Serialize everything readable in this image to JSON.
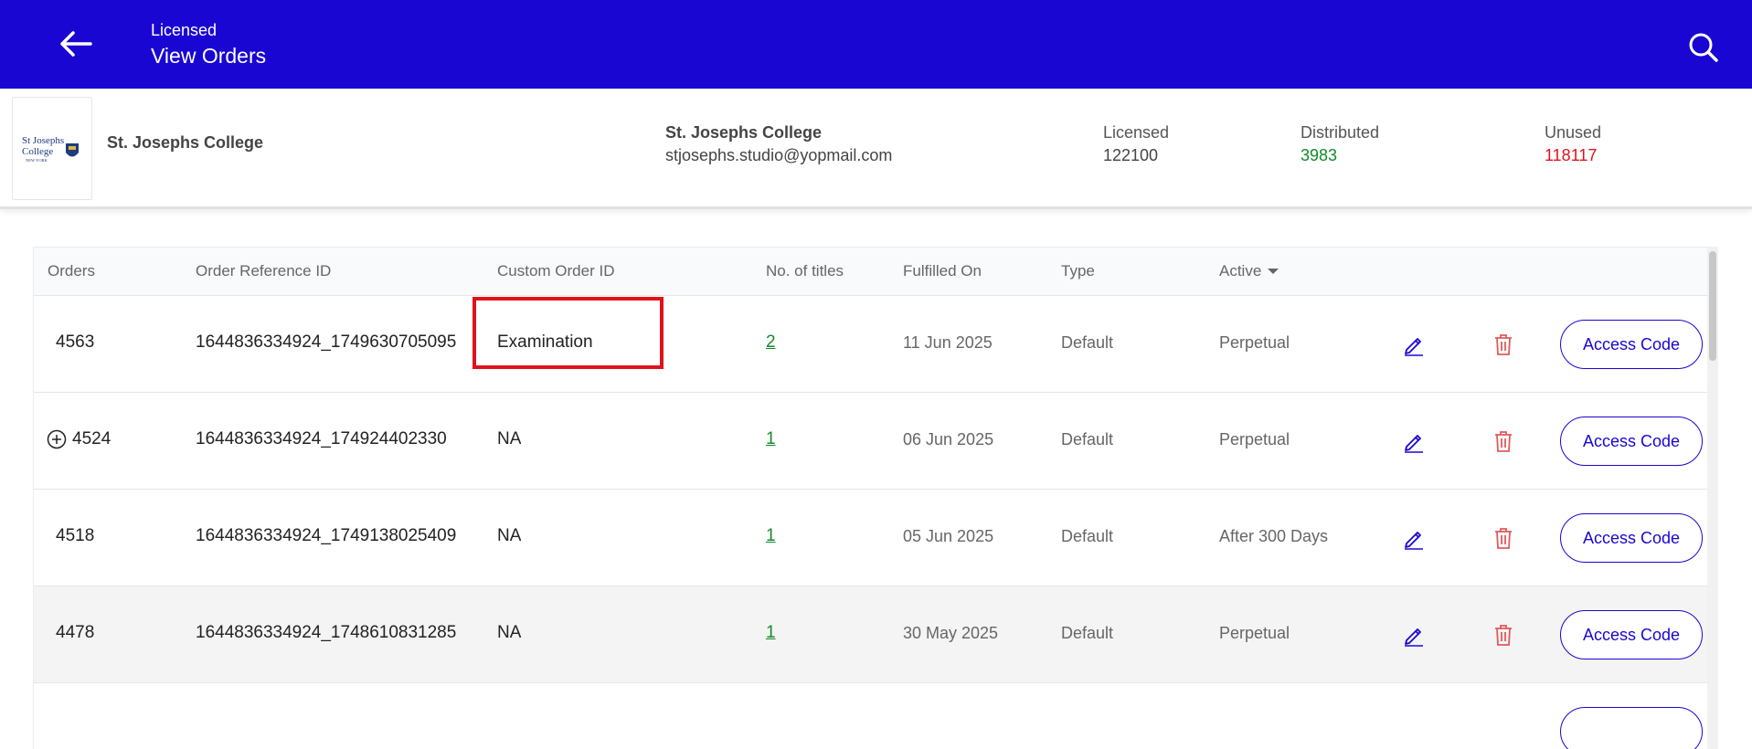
{
  "header": {
    "subtitle": "Licensed",
    "title": "View Orders"
  },
  "institution": {
    "logo_text": "St Josephs College",
    "logo_subtext": "NEW YORK",
    "name": "St. Josephs College",
    "contact_name": "St. Josephs College",
    "email": "stjosephs.studio@yopmail.com"
  },
  "stats": {
    "licensed_label": "Licensed",
    "licensed_value": "122100",
    "distributed_label": "Distributed",
    "distributed_value": "3983",
    "unused_label": "Unused",
    "unused_value": "118117"
  },
  "table": {
    "headers": {
      "orders": "Orders",
      "order_ref": "Order Reference ID",
      "custom_id": "Custom Order ID",
      "titles": "No. of titles",
      "fulfilled": "Fulfilled On",
      "type": "Type",
      "active": "Active"
    },
    "access_label": "Access Code",
    "rows": [
      {
        "order": "4563",
        "ref": "1644836334924_1749630705095",
        "custom": "Examination",
        "titles": "2",
        "fulfilled": "11 Jun 2025",
        "type": "Default",
        "active": "Perpetual"
      },
      {
        "order": "4524",
        "ref": "1644836334924_174924402330",
        "custom": "NA",
        "titles": "1",
        "fulfilled": "06 Jun 2025",
        "type": "Default",
        "active": "Perpetual"
      },
      {
        "order": "4518",
        "ref": "1644836334924_1749138025409",
        "custom": "NA",
        "titles": "1",
        "fulfilled": "05 Jun 2025",
        "type": "Default",
        "active": "After 300 Days"
      },
      {
        "order": "4478",
        "ref": "1644836334924_1748610831285",
        "custom": "NA",
        "titles": "1",
        "fulfilled": "30 May 2025",
        "type": "Default",
        "active": "Perpetual"
      }
    ]
  },
  "colors": {
    "brand": "#1a06d2",
    "distributed": "#14892b",
    "unused": "#e0121d",
    "highlight": "#e0121d"
  },
  "icons": [
    "back-arrow-icon",
    "search-icon",
    "plus-circle-icon",
    "sort-down-icon",
    "edit-icon",
    "delete-icon"
  ]
}
